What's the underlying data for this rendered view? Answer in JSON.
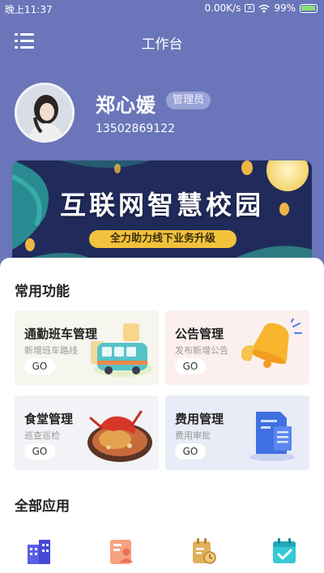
{
  "status_bar": {
    "time": "晚上11:37",
    "network_speed": "0.00K/s",
    "battery": "99%",
    "icons": [
      "sim-icon",
      "wifi-icon",
      "battery-icon"
    ]
  },
  "header": {
    "title": "工作台",
    "menu_icon": "menu-icon"
  },
  "user": {
    "name": "郑心媛",
    "role": "管理员",
    "phone": "13502869122"
  },
  "banner": {
    "title": "互联网智慧校园",
    "subtitle": "全力助力线下业务升级"
  },
  "common_functions": {
    "title": "常用功能",
    "cards": [
      {
        "title": "通勤班车管理",
        "subtitle": "新增班车路线",
        "button": "GO",
        "icon": "bus-icon",
        "bg": "#f6f5ee"
      },
      {
        "title": "公告管理",
        "subtitle": "发布新增公告",
        "button": "GO",
        "icon": "bell-icon",
        "bg": "#fbf0ed"
      },
      {
        "title": "食堂管理",
        "subtitle": "巡查巡检",
        "button": "GO",
        "icon": "food-icon",
        "bg": "#f2f3f6"
      },
      {
        "title": "费用管理",
        "subtitle": "费用审批",
        "button": "GO",
        "icon": "document-icon",
        "bg": "#e8ecf7"
      }
    ]
  },
  "all_apps": {
    "title": "全部应用",
    "icons": [
      "building-icon",
      "contact-card-icon",
      "schedule-icon",
      "calendar-check-icon"
    ]
  },
  "colors": {
    "header_bg": "#6a76b9",
    "banner_bg": "#1f2a59",
    "banner_accent": "#f2c23c"
  }
}
